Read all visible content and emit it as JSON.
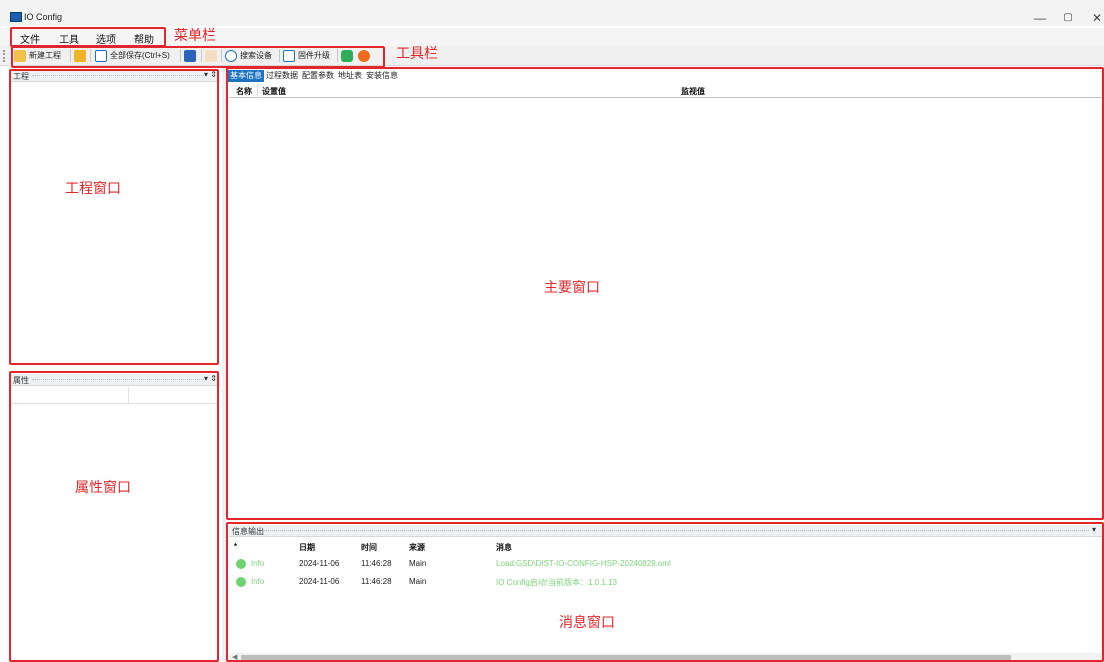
{
  "window": {
    "title": "IO Config",
    "minimize_glyph": "—",
    "maximize_glyph": "▢",
    "close_glyph": "✕"
  },
  "menu": {
    "items": [
      "文件",
      "工具",
      "选项",
      "帮助"
    ]
  },
  "toolbar": {
    "new_project": "新建工程",
    "save_all": "全部保存(Ctrl+S)",
    "search_device": "搜索设备",
    "firmware_upgrade": "固件升级",
    "icons": [
      "new-project-icon",
      "open-folder-icon",
      "save-icon",
      "table-icon",
      "disabled-copy-icon",
      "search-icon",
      "upgrade-icon",
      "green-status-icon",
      "orange-alert-icon"
    ]
  },
  "panels": {
    "project": {
      "title": "工程",
      "pin_glyph": "▾ ⇕"
    },
    "properties": {
      "title": "属性",
      "pin_glyph": "▾ ⇕"
    },
    "output": {
      "title": "信息输出",
      "pin_glyph": "▾"
    }
  },
  "main": {
    "tabs": [
      "基本信息",
      "过程数据",
      "配置参数",
      "地址表",
      "安装信息"
    ],
    "active_tab": "基本信息",
    "columns": [
      "名称",
      "设置值",
      "监视值"
    ]
  },
  "log": {
    "columns": [
      "*",
      "日期",
      "时间",
      "来源",
      "消息"
    ],
    "rows": [
      {
        "level": "Info",
        "date": "2024-11-06",
        "time": "11:46:28",
        "source": "Main",
        "message": "Load:GSD\\DIST-IO-CONFIG-HSP-20240829.oml"
      },
      {
        "level": "Info",
        "date": "2024-11-06",
        "time": "11:46:28",
        "source": "Main",
        "message": "IO Config启动!当前版本：1.0.1.13"
      }
    ]
  },
  "annotations": {
    "menubar": "菜单栏",
    "toolbar": "工具栏",
    "project_window": "工程窗口",
    "property_window": "属性窗口",
    "main_window": "主要窗口",
    "message_window": "消息窗口"
  },
  "colors": {
    "annotation_red": "#e3262b",
    "active_tab_blue": "#1e73be",
    "info_green": "#6fd46f"
  }
}
